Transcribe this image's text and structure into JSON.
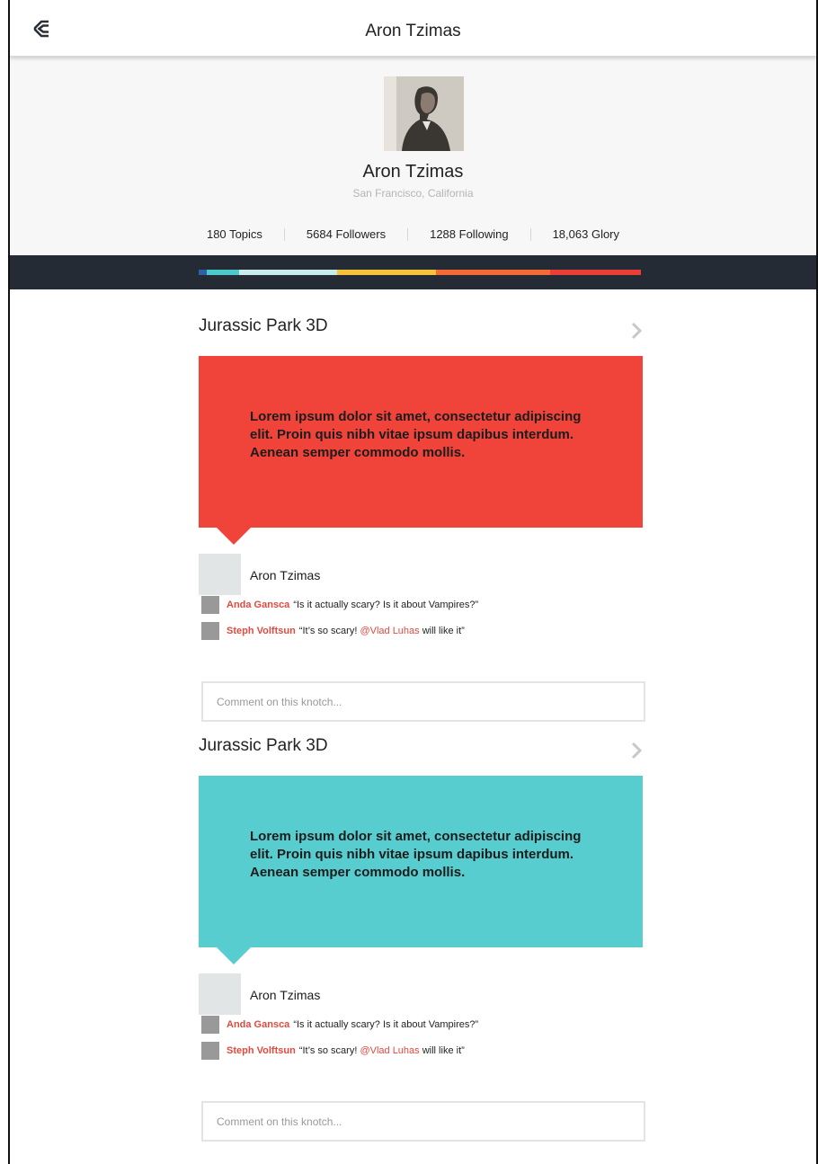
{
  "topbar": {
    "title": "Aron Tzimas",
    "logo_icon": "knotch-logo-icon"
  },
  "profile": {
    "name": "Aron Tzimas",
    "location": "San Francisco, California",
    "stats": [
      {
        "value": "180",
        "label": "Topics"
      },
      {
        "value": "5684",
        "label": "Followers"
      },
      {
        "value": "1288",
        "label": "Following"
      },
      {
        "value": "18,063",
        "label": "Glory"
      }
    ]
  },
  "glory_bar": {
    "background": "#242b35",
    "segments": [
      {
        "color": "#2f5fa8",
        "fraction": 0.018
      },
      {
        "color": "#4ec9cb",
        "fraction": 0.074
      },
      {
        "color": "#c8ecee",
        "fraction": 0.222
      },
      {
        "color": "#f4c33b",
        "fraction": 0.222
      },
      {
        "color": "#f46a36",
        "fraction": 0.258
      },
      {
        "color": "#ea3f37",
        "fraction": 0.206
      }
    ]
  },
  "knotches": [
    {
      "title": "Jurassic Park 3D",
      "color": "#f0443a",
      "text": "Lorem ipsum dolor sit amet, consectetur adipiscing elit. Proin quis nibh vitae ipsum dapibus interdum. Aenean semper commodo mollis.",
      "author": "Aron Tzimas",
      "comments": [
        {
          "user": "Anda Gansca",
          "text": "“Is it actually scary? Is it about Vampires?”"
        },
        {
          "user": "Steph Volftsun",
          "text_before": "“It’s so scary! ",
          "mention": "@Vlad Luhas",
          "text_after": " will like it”"
        }
      ],
      "comment_placeholder": "Comment on this knotch..."
    },
    {
      "title": "Jurassic Park 3D",
      "color": "#58cdcf",
      "text": "Lorem ipsum dolor sit amet, consectetur adipiscing elit. Proin quis nibh vitae ipsum dapibus interdum. Aenean semper commodo mollis.",
      "author": "Aron Tzimas",
      "comments": [
        {
          "user": "Anda Gansca",
          "text": "“Is it actually scary? Is it about Vampires?”"
        },
        {
          "user": "Steph Volftsun",
          "text_before": "“It’s so scary! ",
          "mention": "@Vlad Luhas",
          "text_after": " will like it”"
        }
      ],
      "comment_placeholder": "Comment on this knotch..."
    }
  ]
}
